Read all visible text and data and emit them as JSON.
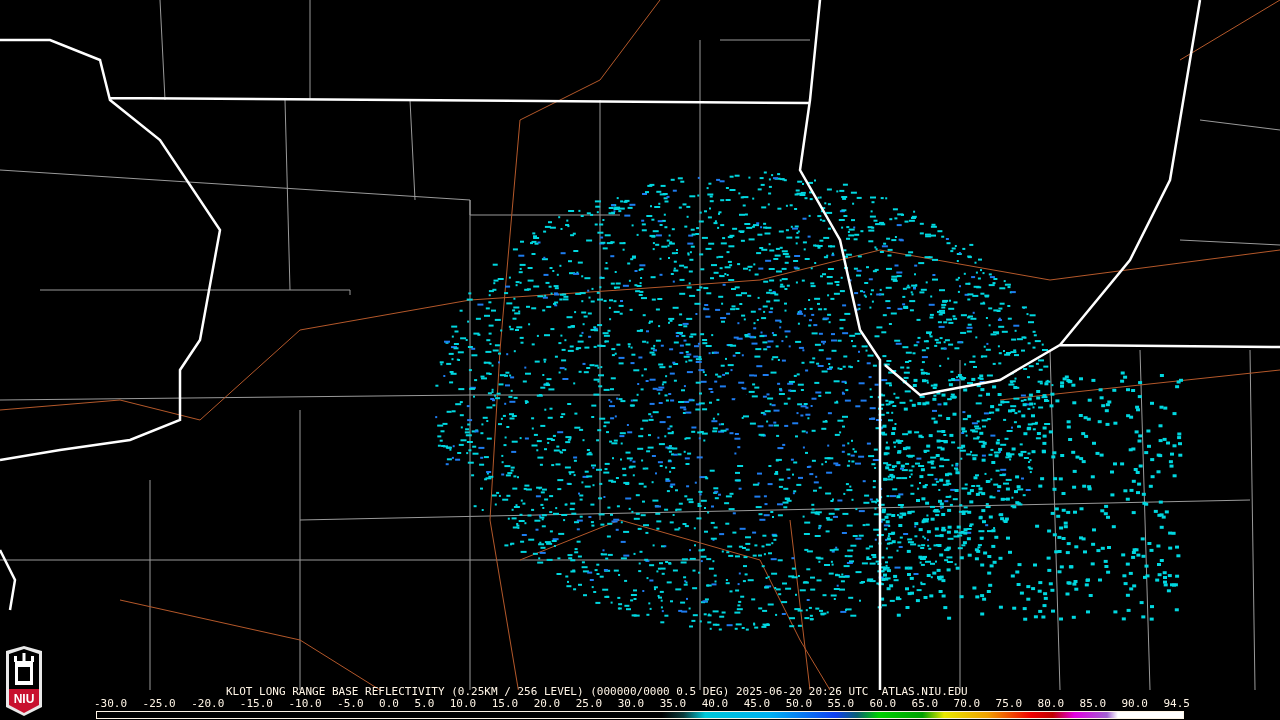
{
  "logo": {
    "text": "NIU"
  },
  "title": "KLOT LONG RANGE BASE REFLECTIVITY (0.25KM / 256 LEVEL) (000000/0000 0.5 DEG) 2025-06-20 20:26 UTC  ATLAS.NIU.EDU",
  "colorbar": {
    "ticks": [
      "-30.0",
      "-25.0",
      "-20.0",
      "-15.0",
      "-10.0",
      "-5.0",
      "0.0",
      "5.0",
      "10.0",
      "15.0",
      "20.0",
      "25.0",
      "30.0",
      "35.0",
      "40.0",
      "45.0",
      "50.0",
      "55.0",
      "60.0",
      "65.0",
      "70.0",
      "75.0",
      "80.0",
      "85.0",
      "90.0",
      "94.5"
    ]
  }
}
